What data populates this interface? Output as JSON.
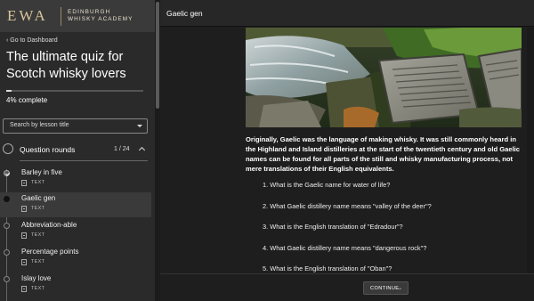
{
  "brand": {
    "logo": "EWA",
    "name_line1": "EDINBURGH",
    "name_line2": "WHISKY ACADEMY"
  },
  "sidebar": {
    "back_link": "‹ Go to Dashboard",
    "course_title": "The ultimate quiz for Scotch whisky lovers",
    "progress_text": "4% complete",
    "progress_value": 0.04,
    "search_label": "Search by lesson title",
    "section": {
      "title": "Question rounds",
      "count": "1 / 24"
    },
    "lessons": [
      {
        "title": "Barley in five",
        "type": "TEXT",
        "state": "done"
      },
      {
        "title": "Gaelic gen",
        "type": "TEXT",
        "state": "active"
      },
      {
        "title": "Abbreviation-able",
        "type": "TEXT",
        "state": "todo"
      },
      {
        "title": "Percentage points",
        "type": "TEXT",
        "state": "todo"
      },
      {
        "title": "Islay love",
        "type": "TEXT",
        "state": "todo"
      }
    ]
  },
  "main": {
    "lesson_title": "Gaelic gen",
    "intro": "Originally, Gaelic was the language of making whisky. It was still commonly heard in the Highland and Island distilleries at the start of the twentieth century and old Gaelic names can be found for all parts of the still and whisky manufacturing process, not mere translations of their English equivalents.",
    "questions": [
      "What is the Gaelic name for water of life?",
      "What Gaelic distillery name means \"valley of the deer\"?",
      "What is the English translation of \"Edradour\"?",
      "What Gaelic distillery name means \"dangerous rock\"?",
      "What is the English translation of \"Oban\"?"
    ],
    "continue_label": "CONTINUE",
    "continue_arrow": "→"
  },
  "colors": {
    "accent_gold": "#d8c59a",
    "sidebar_bg": "#2a2a2a",
    "main_bg": "#1e1e1e"
  }
}
